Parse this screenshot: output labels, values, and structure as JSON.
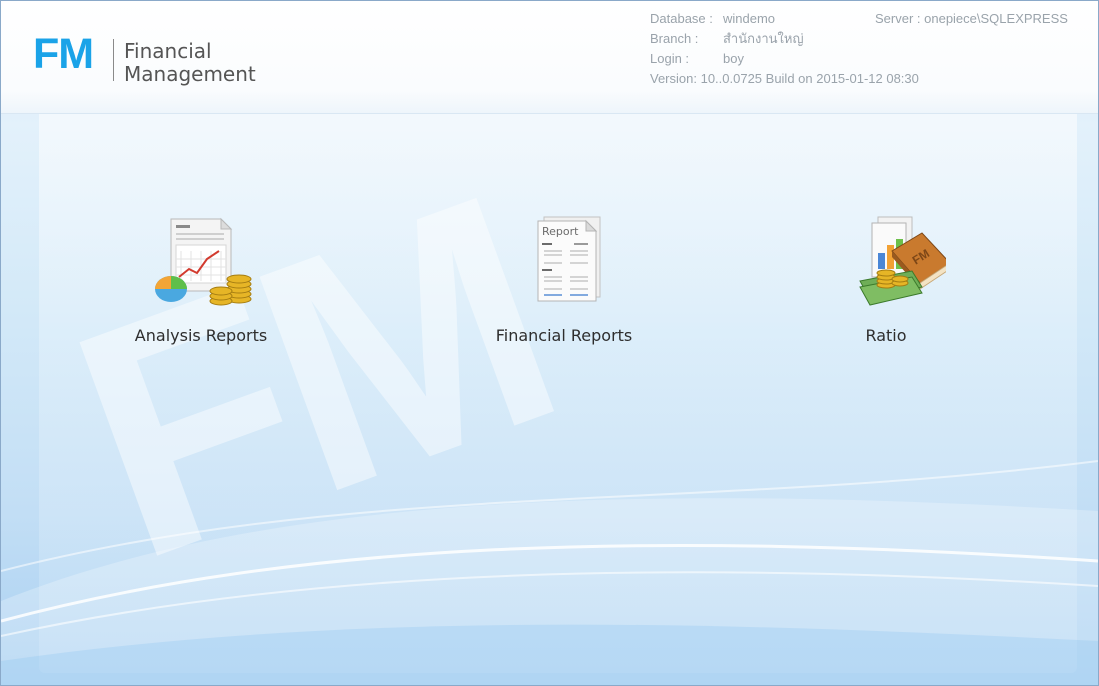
{
  "header": {
    "logo_mark": "FM",
    "logo_line1": "Financial",
    "logo_line2": "Management",
    "database_label": "Database :",
    "database_value": "windemo",
    "branch_label": "Branch :",
    "branch_value": "สำนักงานใหญ่",
    "login_label": "Login :",
    "login_value": "boy",
    "version_text": "Version: 10..0.0725  Build on 2015-01-12 08:30",
    "server_text": "Server : onepiece\\SQLEXPRESS"
  },
  "watermark": "FM",
  "modules": [
    {
      "label": "Analysis Reports",
      "icon": "analysis-report-icon"
    },
    {
      "label": "Financial Reports",
      "icon": "financial-report-icon"
    },
    {
      "label": "Ratio",
      "icon": "ratio-book-icon"
    }
  ],
  "report_icon_text": "Report",
  "book_icon_text": "FM",
  "colors": {
    "brand": "#1aa3e8",
    "info_text": "#9aa3ab",
    "background": "#cfe6f8"
  }
}
